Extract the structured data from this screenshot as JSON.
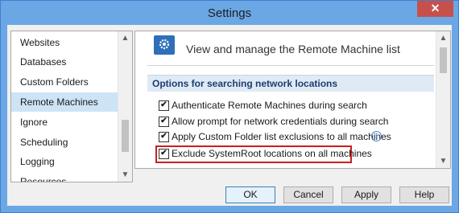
{
  "window": {
    "title": "Settings",
    "close_glyph": "✕"
  },
  "left_list": {
    "items": [
      {
        "label": "Websites",
        "selected": false
      },
      {
        "label": "Databases",
        "selected": false
      },
      {
        "label": "Custom Folders",
        "selected": false
      },
      {
        "label": "Remote Machines",
        "selected": true
      },
      {
        "label": "Ignore",
        "selected": false
      },
      {
        "label": "Scheduling",
        "selected": false
      },
      {
        "label": "Logging",
        "selected": false
      },
      {
        "label": "Resources",
        "selected": false
      }
    ],
    "scroll_up": "▲",
    "scroll_down": "▼"
  },
  "content": {
    "header_icon": "gear-icon",
    "header_text": "View and manage the Remote Machine list",
    "section_title": "Options for searching network locations",
    "options": [
      {
        "label": "Authenticate Remote Machines during search",
        "checked": true
      },
      {
        "label": "Allow prompt for network credentials during search",
        "checked": true
      },
      {
        "label": "Apply Custom Folder list exclusions to all machines",
        "checked": true
      },
      {
        "label": "Exclude SystemRoot locations on all machines",
        "checked": true
      }
    ],
    "info_glyph": "i",
    "check_glyph": "✔",
    "scroll_up": "▲",
    "scroll_down": "▼",
    "highlight_color": "#c8201f"
  },
  "buttons": {
    "ok": "OK",
    "cancel": "Cancel",
    "apply": "Apply",
    "help": "Help"
  }
}
